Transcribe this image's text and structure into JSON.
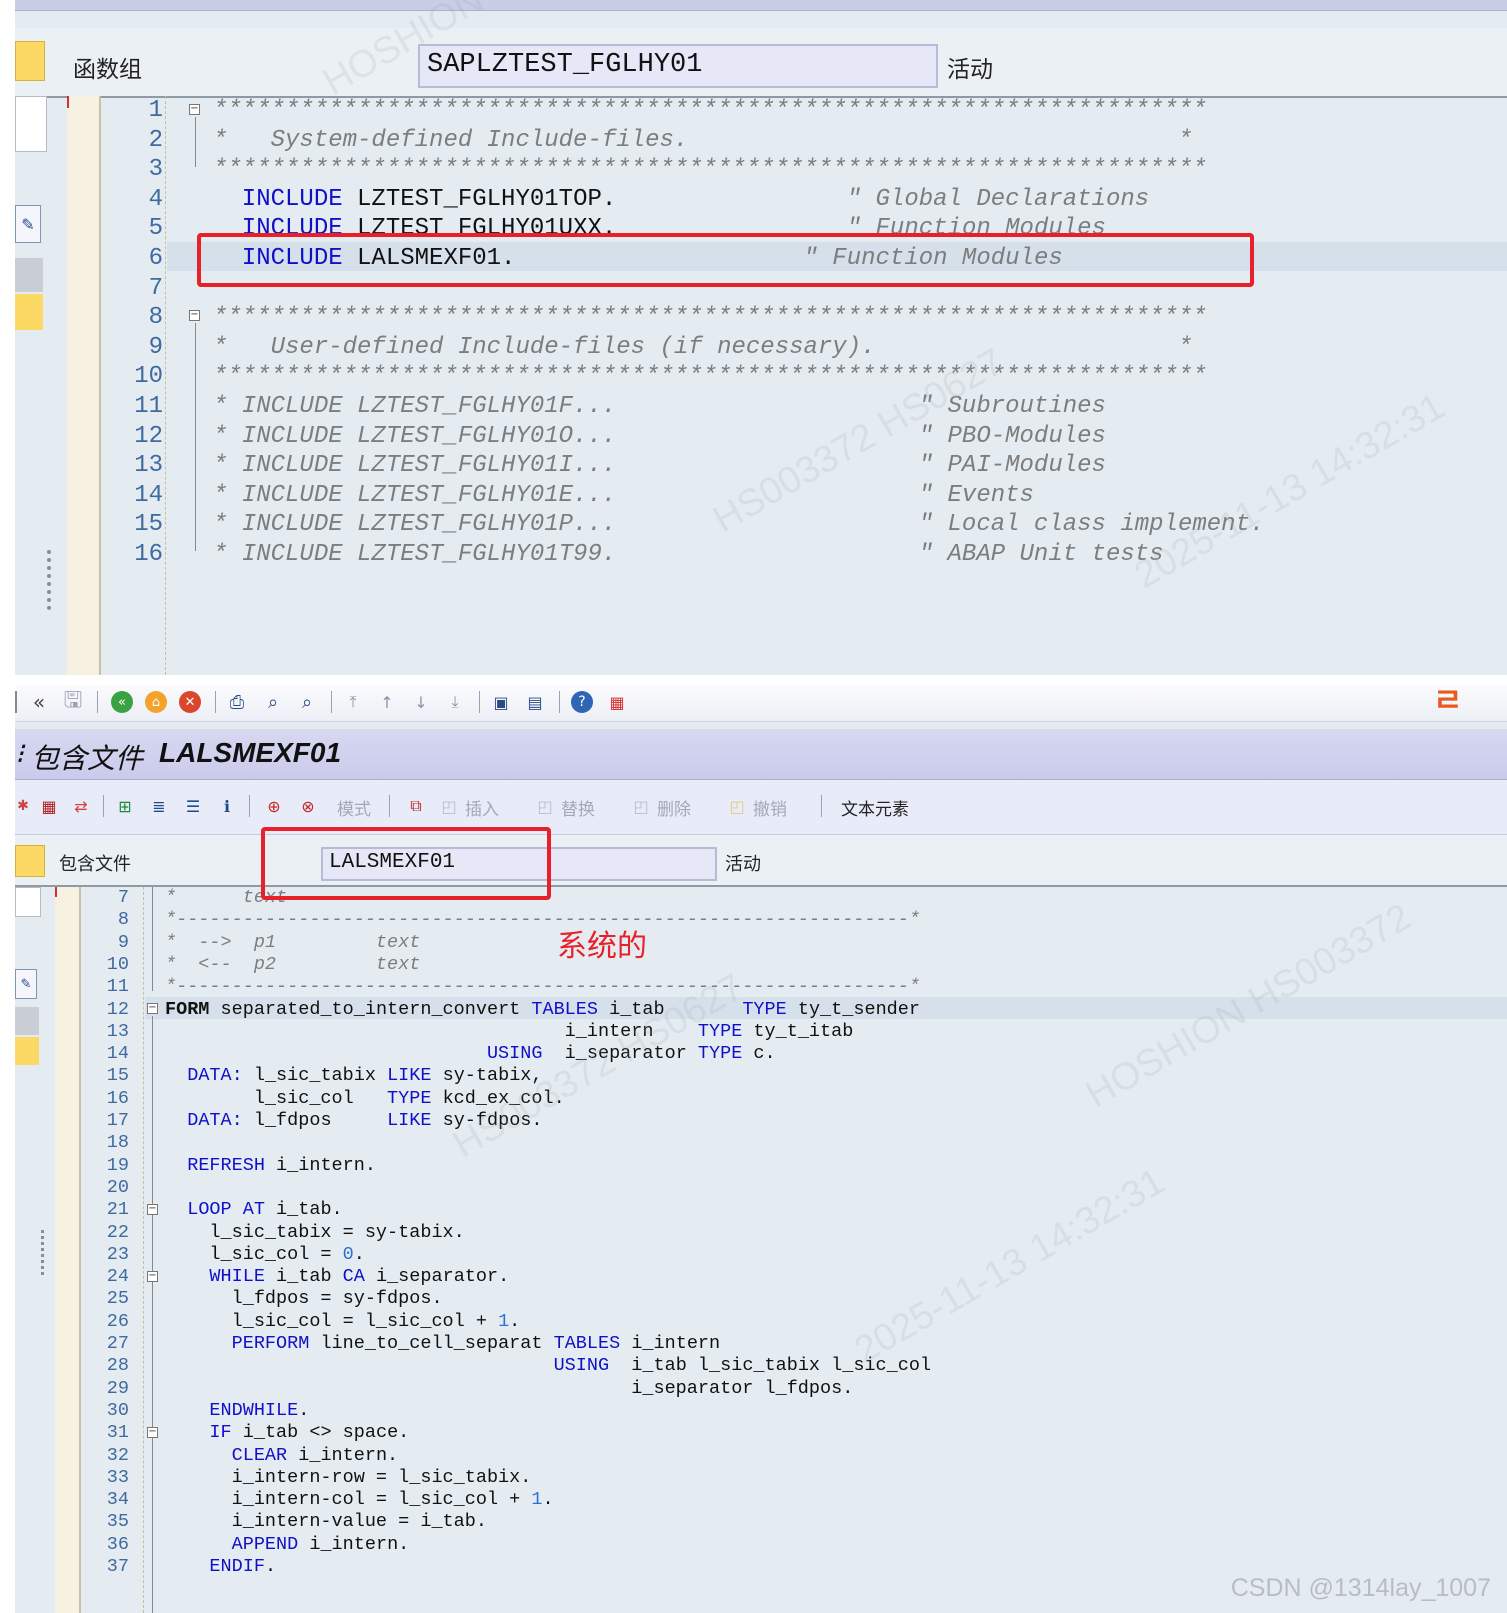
{
  "top_panel": {
    "function_group_label": "函数组",
    "function_group_value": "SAPLZTEST_FGLHY01",
    "status": "活动",
    "lines": [
      {
        "n": "1",
        "segs": [
          {
            "t": "*********************************************************************",
            "c": "cm"
          }
        ]
      },
      {
        "n": "2",
        "segs": [
          {
            "t": "*   System-defined Include-files.                                  *",
            "c": "cm"
          }
        ]
      },
      {
        "n": "3",
        "segs": [
          {
            "t": "*********************************************************************",
            "c": "cm"
          }
        ]
      },
      {
        "n": "4",
        "segs": [
          {
            "t": "  INCLUDE",
            "c": "kw"
          },
          {
            "t": " LZTEST_FGLHY01TOP.",
            "c": "id"
          },
          {
            "t": "                \" Global Declarations",
            "c": "cm"
          }
        ]
      },
      {
        "n": "5",
        "segs": [
          {
            "t": "  INCLUDE",
            "c": "kw"
          },
          {
            "t": " LZTEST_FGLHY01UXX.",
            "c": "id"
          },
          {
            "t": "                \" Function Modules",
            "c": "cm"
          }
        ]
      },
      {
        "n": "6",
        "segs": [
          {
            "t": "  INCLUDE",
            "c": "kw"
          },
          {
            "t": " LALSMEXF01.",
            "c": "id"
          },
          {
            "t": "                    \" Function Modules",
            "c": "cm"
          }
        ]
      },
      {
        "n": "7",
        "segs": [
          {
            "t": "",
            "c": "id"
          }
        ]
      },
      {
        "n": "8",
        "segs": [
          {
            "t": "*********************************************************************",
            "c": "cm"
          }
        ]
      },
      {
        "n": "9",
        "segs": [
          {
            "t": "*   User-defined Include-files (if necessary).                     *",
            "c": "cm"
          }
        ]
      },
      {
        "n": "10",
        "segs": [
          {
            "t": "*********************************************************************",
            "c": "cm"
          }
        ]
      },
      {
        "n": "11",
        "segs": [
          {
            "t": "* INCLUDE LZTEST_FGLHY01F...                     \" Subroutines",
            "c": "cm"
          }
        ]
      },
      {
        "n": "12",
        "segs": [
          {
            "t": "* INCLUDE LZTEST_FGLHY01O...                     \" PBO-Modules",
            "c": "cm"
          }
        ]
      },
      {
        "n": "13",
        "segs": [
          {
            "t": "* INCLUDE LZTEST_FGLHY01I...                     \" PAI-Modules",
            "c": "cm"
          }
        ]
      },
      {
        "n": "14",
        "segs": [
          {
            "t": "* INCLUDE LZTEST_FGLHY01E...                     \" Events",
            "c": "cm"
          }
        ]
      },
      {
        "n": "15",
        "segs": [
          {
            "t": "* INCLUDE LZTEST_FGLHY01P...                     \" Local class implement.",
            "c": "cm"
          }
        ]
      },
      {
        "n": "16",
        "segs": [
          {
            "t": "* INCLUDE LZTEST_FGLHY01T99.                     \" ABAP Unit tests",
            "c": "cm"
          }
        ]
      }
    ]
  },
  "bottom_panel": {
    "title_prefix": "包含文件",
    "title_name": "LALSMEXF01",
    "toolbar_labels": {
      "mode": "模式",
      "insert": "插入",
      "replace": "替换",
      "delete": "删除",
      "undo": "撤销",
      "text_elements": "文本元素"
    },
    "include_label": "包含文件",
    "include_value": "LALSMEXF01",
    "status": "活动",
    "annotation": "系统的",
    "lines": [
      {
        "n": "7",
        "segs": [
          {
            "t": "*      text",
            "c": "cm"
          }
        ]
      },
      {
        "n": "8",
        "segs": [
          {
            "t": "*------------------------------------------------------------------*",
            "c": "cm"
          }
        ]
      },
      {
        "n": "9",
        "segs": [
          {
            "t": "*  -->  p1         text",
            "c": "cm"
          }
        ]
      },
      {
        "n": "10",
        "segs": [
          {
            "t": "*  <--  p2         text",
            "c": "cm"
          }
        ]
      },
      {
        "n": "11",
        "segs": [
          {
            "t": "*------------------------------------------------------------------*",
            "c": "cm"
          }
        ]
      },
      {
        "n": "12",
        "segs": [
          {
            "t": "FORM",
            "c": "kwb"
          },
          {
            "t": " separated_to_intern_convert ",
            "c": "id"
          },
          {
            "t": "TABLES",
            "c": "kw"
          },
          {
            "t": " i_tab       ",
            "c": "id"
          },
          {
            "t": "TYPE",
            "c": "kw"
          },
          {
            "t": " ty_t_sender",
            "c": "id"
          }
        ]
      },
      {
        "n": "13",
        "segs": [
          {
            "t": "                                    i_intern    ",
            "c": "id"
          },
          {
            "t": "TYPE",
            "c": "kw"
          },
          {
            "t": " ty_t_itab",
            "c": "id"
          }
        ]
      },
      {
        "n": "14",
        "segs": [
          {
            "t": "                             ",
            "c": "id"
          },
          {
            "t": "USING",
            "c": "kw"
          },
          {
            "t": "  i_separator ",
            "c": "id"
          },
          {
            "t": "TYPE",
            "c": "kw"
          },
          {
            "t": " c.",
            "c": "id"
          }
        ]
      },
      {
        "n": "15",
        "segs": [
          {
            "t": "  ",
            "c": "id"
          },
          {
            "t": "DATA:",
            "c": "kw"
          },
          {
            "t": " l_sic_tabix ",
            "c": "id"
          },
          {
            "t": "LIKE",
            "c": "kw"
          },
          {
            "t": " sy-tabix,",
            "c": "id"
          }
        ]
      },
      {
        "n": "16",
        "segs": [
          {
            "t": "        l_sic_col   ",
            "c": "id"
          },
          {
            "t": "TYPE",
            "c": "kw"
          },
          {
            "t": " kcd_ex_col.",
            "c": "id"
          }
        ]
      },
      {
        "n": "17",
        "segs": [
          {
            "t": "  ",
            "c": "id"
          },
          {
            "t": "DATA:",
            "c": "kw"
          },
          {
            "t": " l_fdpos     ",
            "c": "id"
          },
          {
            "t": "LIKE",
            "c": "kw"
          },
          {
            "t": " sy-fdpos.",
            "c": "id"
          }
        ]
      },
      {
        "n": "18",
        "segs": [
          {
            "t": "",
            "c": "id"
          }
        ]
      },
      {
        "n": "19",
        "segs": [
          {
            "t": "  ",
            "c": "id"
          },
          {
            "t": "REFRESH",
            "c": "kw"
          },
          {
            "t": " i_intern.",
            "c": "id"
          }
        ]
      },
      {
        "n": "20",
        "segs": [
          {
            "t": "",
            "c": "id"
          }
        ]
      },
      {
        "n": "21",
        "segs": [
          {
            "t": "  ",
            "c": "id"
          },
          {
            "t": "LOOP AT",
            "c": "kw"
          },
          {
            "t": " i_tab.",
            "c": "id"
          }
        ]
      },
      {
        "n": "22",
        "segs": [
          {
            "t": "    l_sic_tabix = sy-tabix.",
            "c": "id"
          }
        ]
      },
      {
        "n": "23",
        "segs": [
          {
            "t": "    l_sic_col = ",
            "c": "id"
          },
          {
            "t": "0",
            "c": "num"
          },
          {
            "t": ".",
            "c": "id"
          }
        ]
      },
      {
        "n": "24",
        "segs": [
          {
            "t": "    ",
            "c": "id"
          },
          {
            "t": "WHILE",
            "c": "kw"
          },
          {
            "t": " i_tab ",
            "c": "id"
          },
          {
            "t": "CA",
            "c": "kw"
          },
          {
            "t": " i_separator.",
            "c": "id"
          }
        ]
      },
      {
        "n": "25",
        "segs": [
          {
            "t": "      l_fdpos = sy-fdpos.",
            "c": "id"
          }
        ]
      },
      {
        "n": "26",
        "segs": [
          {
            "t": "      l_sic_col = l_sic_col + ",
            "c": "id"
          },
          {
            "t": "1",
            "c": "num"
          },
          {
            "t": ".",
            "c": "id"
          }
        ]
      },
      {
        "n": "27",
        "segs": [
          {
            "t": "      ",
            "c": "id"
          },
          {
            "t": "PERFORM",
            "c": "kw"
          },
          {
            "t": " line_to_cell_separat ",
            "c": "id"
          },
          {
            "t": "TABLES",
            "c": "kw"
          },
          {
            "t": " i_intern",
            "c": "id"
          }
        ]
      },
      {
        "n": "28",
        "segs": [
          {
            "t": "                                   ",
            "c": "id"
          },
          {
            "t": "USING",
            "c": "kw"
          },
          {
            "t": "  i_tab l_sic_tabix l_sic_col",
            "c": "id"
          }
        ]
      },
      {
        "n": "29",
        "segs": [
          {
            "t": "                                          i_separator l_fdpos.",
            "c": "id"
          }
        ]
      },
      {
        "n": "30",
        "segs": [
          {
            "t": "    ",
            "c": "id"
          },
          {
            "t": "ENDWHILE",
            "c": "kw"
          },
          {
            "t": ".",
            "c": "id"
          }
        ]
      },
      {
        "n": "31",
        "segs": [
          {
            "t": "    ",
            "c": "id"
          },
          {
            "t": "IF",
            "c": "kw"
          },
          {
            "t": " i_tab <> space.",
            "c": "id"
          }
        ]
      },
      {
        "n": "32",
        "segs": [
          {
            "t": "      ",
            "c": "id"
          },
          {
            "t": "CLEAR",
            "c": "kw"
          },
          {
            "t": " i_intern.",
            "c": "id"
          }
        ]
      },
      {
        "n": "33",
        "segs": [
          {
            "t": "      i_intern-row = l_sic_tabix.",
            "c": "id"
          }
        ]
      },
      {
        "n": "34",
        "segs": [
          {
            "t": "      i_intern-col = l_sic_col + ",
            "c": "id"
          },
          {
            "t": "1",
            "c": "num"
          },
          {
            "t": ".",
            "c": "id"
          }
        ]
      },
      {
        "n": "35",
        "segs": [
          {
            "t": "      i_intern-value = i_tab.",
            "c": "id"
          }
        ]
      },
      {
        "n": "36",
        "segs": [
          {
            "t": "      ",
            "c": "id"
          },
          {
            "t": "APPEND",
            "c": "kw"
          },
          {
            "t": " i_intern.",
            "c": "id"
          }
        ]
      },
      {
        "n": "37",
        "segs": [
          {
            "t": "    ",
            "c": "id"
          },
          {
            "t": "ENDIF",
            "c": "kw"
          },
          {
            "t": ".",
            "c": "id"
          }
        ]
      }
    ]
  },
  "credit": "CSDN @1314lay_1007",
  "colors": {
    "keyword": "#1010c8",
    "comment": "#7d7d7d",
    "number": "#2a70d8",
    "highlight_box": "#e8202a",
    "editor_bg": "#e5ecf1"
  }
}
